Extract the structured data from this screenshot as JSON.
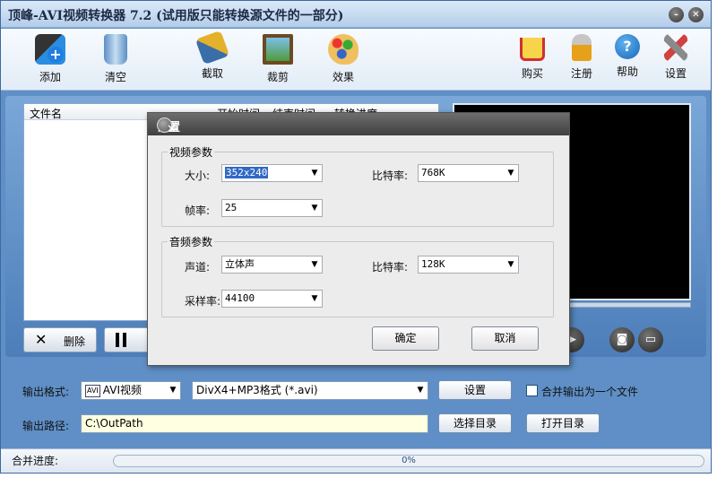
{
  "window": {
    "title": "顶峰-AVI视频转换器 7.2 (试用版只能转换源文件的一部分)"
  },
  "toolbar": {
    "add": "添加",
    "clear": "清空",
    "crop_clip": "截取",
    "crop": "裁剪",
    "effect": "效果",
    "buy": "购买",
    "register": "注册",
    "help": "帮助",
    "settings": "设置"
  },
  "filelist": {
    "columns": [
      "文件名",
      "开始时间",
      "结束时间",
      "转换进度"
    ]
  },
  "panel_buttons": {
    "delete": "删除"
  },
  "output": {
    "format_label": "输出格式:",
    "format_value": "AVI视频",
    "format_badge": "AVI",
    "codec_value": "DivX4+MP3格式 (*.avi)",
    "settings_button": "设置",
    "merge_label": "合并输出为一个文件",
    "path_label": "输出路径:",
    "path_value": "C:\\OutPath",
    "browse_button": "选择目录",
    "open_button": "打开目录"
  },
  "status": {
    "merge_progress_label": "合并进度:",
    "merge_progress_value": "0%",
    "progress": 0
  },
  "dialog": {
    "title": "设置",
    "video": {
      "group": "视频参数",
      "size_label": "大小:",
      "size_value": "352x240",
      "bitrate_label": "比特率:",
      "bitrate_value": "768K",
      "framerate_label": "帧率:",
      "framerate_value": "25"
    },
    "audio": {
      "group": "音频参数",
      "channel_label": "声道:",
      "channel_value": "立体声",
      "bitrate_label": "比特率:",
      "bitrate_value": "128K",
      "samplerate_label": "采样率:",
      "samplerate_value": "44100"
    },
    "ok": "确定",
    "cancel": "取消"
  }
}
